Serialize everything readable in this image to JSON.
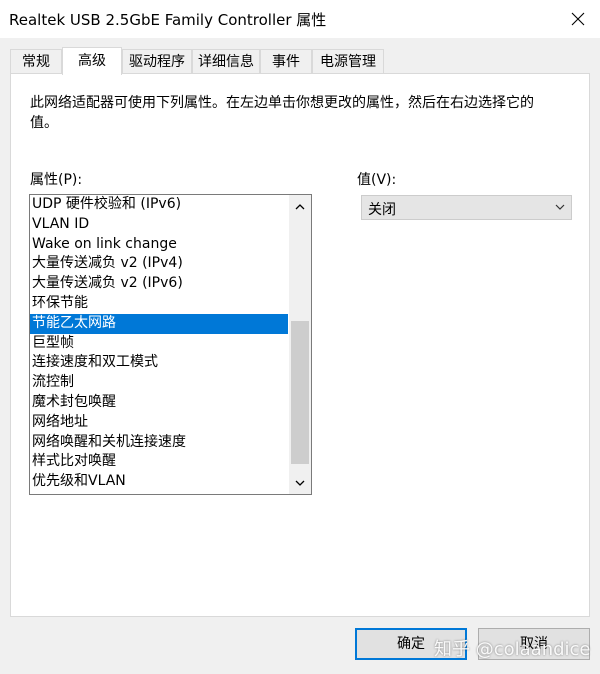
{
  "window": {
    "title": "Realtek USB 2.5GbE Family Controller 属性"
  },
  "tabs": [
    {
      "label": "常规"
    },
    {
      "label": "高级"
    },
    {
      "label": "驱动程序"
    },
    {
      "label": "详细信息"
    },
    {
      "label": "事件"
    },
    {
      "label": "电源管理"
    }
  ],
  "active_tab": "高级",
  "panel": {
    "description": "此网络适配器可使用下列属性。在左边单击你想更改的属性，然后在右边选择它的值。",
    "property_label": "属性(P):",
    "value_label": "值(V):",
    "properties": [
      "UDP 硬件校验和 (IPv6)",
      "VLAN ID",
      "Wake on link change",
      "大量传送减负 v2 (IPv4)",
      "大量传送减负 v2 (IPv6)",
      "环保节能",
      "节能乙太网路",
      "巨型帧",
      "连接速度和双工模式",
      "流控制",
      "魔术封包唤醒",
      "网络地址",
      "网络唤醒和关机连接速度",
      "样式比对唤醒",
      "优先级和VLAN"
    ],
    "selected_property": "节能乙太网路",
    "value_selected": "关闭",
    "scroll": {
      "position": 0.93,
      "visible_fraction": 0.56
    }
  },
  "buttons": {
    "ok": "确定",
    "cancel": "取消"
  },
  "watermark": "知乎 @colaandice",
  "colors": {
    "selection": "#0078d7",
    "panel_bg": "#ffffff",
    "window_bg": "#f0f0f0"
  },
  "icons": {
    "close": "close-icon",
    "scroll_up": "chevron-up-icon",
    "scroll_down": "chevron-down-icon",
    "combo": "chevron-down-icon"
  }
}
